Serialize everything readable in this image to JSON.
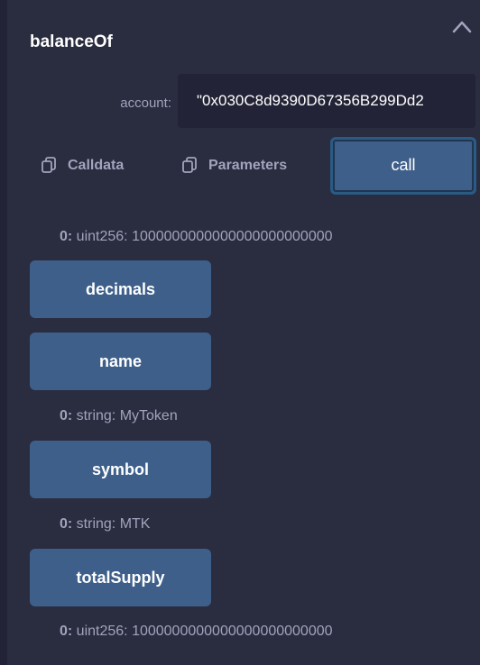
{
  "balance_of": {
    "title": "balanceOf",
    "account_label": "account:",
    "account_value": "\"0x030C8d9390D67356B299Dd2",
    "calldata_label": "Calldata",
    "parameters_label": "Parameters",
    "call_label": "call",
    "result": {
      "index": "0:",
      "value": " uint256: 1000000000000000000000000"
    }
  },
  "functions": [
    {
      "label": "decimals",
      "result": null
    },
    {
      "label": "name",
      "result": {
        "index": "0:",
        "value": " string: MyToken"
      }
    },
    {
      "label": "symbol",
      "result": {
        "index": "0:",
        "value": " string: MTK"
      }
    },
    {
      "label": "totalSupply",
      "result": {
        "index": "0:",
        "value": " uint256: 1000000000000000000000000"
      }
    }
  ],
  "icons": {
    "collapse": "chevron-up-icon",
    "copy": "copy-icon"
  },
  "colors": {
    "background": "#222336",
    "panel": "#2a2c3f",
    "button": "#3e5f8a",
    "text_muted": "#a2a3bd",
    "text_bright": "#ffffff"
  }
}
